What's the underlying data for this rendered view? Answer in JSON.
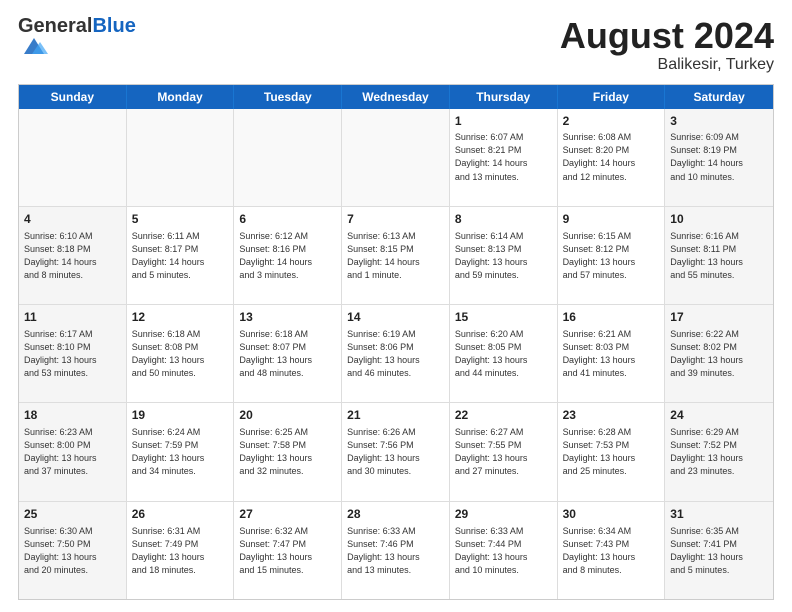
{
  "logo": {
    "general": "General",
    "blue": "Blue"
  },
  "title": "August 2024",
  "subtitle": "Balikesir, Turkey",
  "days_of_week": [
    "Sunday",
    "Monday",
    "Tuesday",
    "Wednesday",
    "Thursday",
    "Friday",
    "Saturday"
  ],
  "weeks": [
    [
      {
        "day": "",
        "text": "",
        "empty": true
      },
      {
        "day": "",
        "text": "",
        "empty": true
      },
      {
        "day": "",
        "text": "",
        "empty": true
      },
      {
        "day": "",
        "text": "",
        "empty": true
      },
      {
        "day": "1",
        "text": "Sunrise: 6:07 AM\nSunset: 8:21 PM\nDaylight: 14 hours\nand 13 minutes.",
        "shaded": false
      },
      {
        "day": "2",
        "text": "Sunrise: 6:08 AM\nSunset: 8:20 PM\nDaylight: 14 hours\nand 12 minutes.",
        "shaded": false
      },
      {
        "day": "3",
        "text": "Sunrise: 6:09 AM\nSunset: 8:19 PM\nDaylight: 14 hours\nand 10 minutes.",
        "shaded": true
      }
    ],
    [
      {
        "day": "4",
        "text": "Sunrise: 6:10 AM\nSunset: 8:18 PM\nDaylight: 14 hours\nand 8 minutes.",
        "shaded": true
      },
      {
        "day": "5",
        "text": "Sunrise: 6:11 AM\nSunset: 8:17 PM\nDaylight: 14 hours\nand 5 minutes.",
        "shaded": false
      },
      {
        "day": "6",
        "text": "Sunrise: 6:12 AM\nSunset: 8:16 PM\nDaylight: 14 hours\nand 3 minutes.",
        "shaded": false
      },
      {
        "day": "7",
        "text": "Sunrise: 6:13 AM\nSunset: 8:15 PM\nDaylight: 14 hours\nand 1 minute.",
        "shaded": false
      },
      {
        "day": "8",
        "text": "Sunrise: 6:14 AM\nSunset: 8:13 PM\nDaylight: 13 hours\nand 59 minutes.",
        "shaded": false
      },
      {
        "day": "9",
        "text": "Sunrise: 6:15 AM\nSunset: 8:12 PM\nDaylight: 13 hours\nand 57 minutes.",
        "shaded": false
      },
      {
        "day": "10",
        "text": "Sunrise: 6:16 AM\nSunset: 8:11 PM\nDaylight: 13 hours\nand 55 minutes.",
        "shaded": true
      }
    ],
    [
      {
        "day": "11",
        "text": "Sunrise: 6:17 AM\nSunset: 8:10 PM\nDaylight: 13 hours\nand 53 minutes.",
        "shaded": true
      },
      {
        "day": "12",
        "text": "Sunrise: 6:18 AM\nSunset: 8:08 PM\nDaylight: 13 hours\nand 50 minutes.",
        "shaded": false
      },
      {
        "day": "13",
        "text": "Sunrise: 6:18 AM\nSunset: 8:07 PM\nDaylight: 13 hours\nand 48 minutes.",
        "shaded": false
      },
      {
        "day": "14",
        "text": "Sunrise: 6:19 AM\nSunset: 8:06 PM\nDaylight: 13 hours\nand 46 minutes.",
        "shaded": false
      },
      {
        "day": "15",
        "text": "Sunrise: 6:20 AM\nSunset: 8:05 PM\nDaylight: 13 hours\nand 44 minutes.",
        "shaded": false
      },
      {
        "day": "16",
        "text": "Sunrise: 6:21 AM\nSunset: 8:03 PM\nDaylight: 13 hours\nand 41 minutes.",
        "shaded": false
      },
      {
        "day": "17",
        "text": "Sunrise: 6:22 AM\nSunset: 8:02 PM\nDaylight: 13 hours\nand 39 minutes.",
        "shaded": true
      }
    ],
    [
      {
        "day": "18",
        "text": "Sunrise: 6:23 AM\nSunset: 8:00 PM\nDaylight: 13 hours\nand 37 minutes.",
        "shaded": true
      },
      {
        "day": "19",
        "text": "Sunrise: 6:24 AM\nSunset: 7:59 PM\nDaylight: 13 hours\nand 34 minutes.",
        "shaded": false
      },
      {
        "day": "20",
        "text": "Sunrise: 6:25 AM\nSunset: 7:58 PM\nDaylight: 13 hours\nand 32 minutes.",
        "shaded": false
      },
      {
        "day": "21",
        "text": "Sunrise: 6:26 AM\nSunset: 7:56 PM\nDaylight: 13 hours\nand 30 minutes.",
        "shaded": false
      },
      {
        "day": "22",
        "text": "Sunrise: 6:27 AM\nSunset: 7:55 PM\nDaylight: 13 hours\nand 27 minutes.",
        "shaded": false
      },
      {
        "day": "23",
        "text": "Sunrise: 6:28 AM\nSunset: 7:53 PM\nDaylight: 13 hours\nand 25 minutes.",
        "shaded": false
      },
      {
        "day": "24",
        "text": "Sunrise: 6:29 AM\nSunset: 7:52 PM\nDaylight: 13 hours\nand 23 minutes.",
        "shaded": true
      }
    ],
    [
      {
        "day": "25",
        "text": "Sunrise: 6:30 AM\nSunset: 7:50 PM\nDaylight: 13 hours\nand 20 minutes.",
        "shaded": true
      },
      {
        "day": "26",
        "text": "Sunrise: 6:31 AM\nSunset: 7:49 PM\nDaylight: 13 hours\nand 18 minutes.",
        "shaded": false
      },
      {
        "day": "27",
        "text": "Sunrise: 6:32 AM\nSunset: 7:47 PM\nDaylight: 13 hours\nand 15 minutes.",
        "shaded": false
      },
      {
        "day": "28",
        "text": "Sunrise: 6:33 AM\nSunset: 7:46 PM\nDaylight: 13 hours\nand 13 minutes.",
        "shaded": false
      },
      {
        "day": "29",
        "text": "Sunrise: 6:33 AM\nSunset: 7:44 PM\nDaylight: 13 hours\nand 10 minutes.",
        "shaded": false
      },
      {
        "day": "30",
        "text": "Sunrise: 6:34 AM\nSunset: 7:43 PM\nDaylight: 13 hours\nand 8 minutes.",
        "shaded": false
      },
      {
        "day": "31",
        "text": "Sunrise: 6:35 AM\nSunset: 7:41 PM\nDaylight: 13 hours\nand 5 minutes.",
        "shaded": true
      }
    ]
  ]
}
